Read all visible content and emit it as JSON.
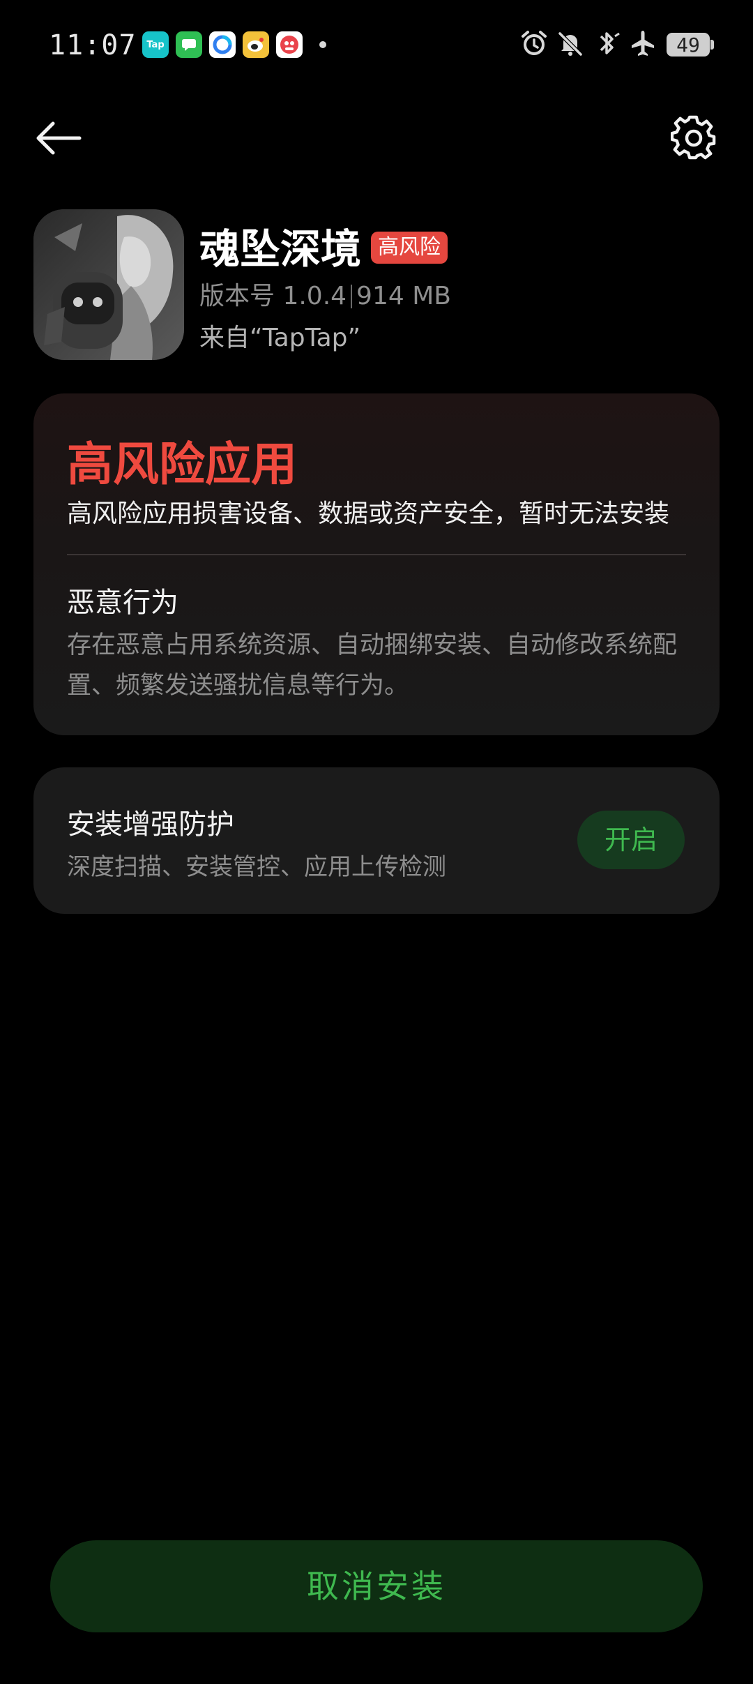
{
  "status_bar": {
    "time": "11:07",
    "notification_icons": [
      {
        "name": "taptap-app-icon",
        "label": "Tap",
        "color": "#17c3c9"
      },
      {
        "name": "messages-app-icon",
        "label": "",
        "color": "#2fbf54"
      },
      {
        "name": "browser-app-icon",
        "label": "",
        "color": "#2f7ff0"
      },
      {
        "name": "weibo-app-icon",
        "label": "",
        "color": "#f0a32e"
      },
      {
        "name": "game-app-icon",
        "label": "",
        "color": "#e9434b"
      }
    ],
    "battery_level": "49"
  },
  "app": {
    "name": "魂坠深境",
    "risk_badge": "高风险",
    "version": "版本号 1.0.4",
    "size": "914 MB",
    "source": "来自“TapTap”"
  },
  "risk_card": {
    "title": "高风险应用",
    "description": "高风险应用损害设备、数据或资产安全，暂时无法安装",
    "behavior_title": "恶意行为",
    "behavior_description": "存在恶意占用系统资源、自动捆绑安装、自动修改系统配置、频繁发送骚扰信息等行为。"
  },
  "protection_card": {
    "title": "安装增强防护",
    "description": "深度扫描、安装管控、应用上传检测",
    "button_label": "开启"
  },
  "bottom": {
    "cancel_label": "取消安装"
  },
  "colors": {
    "background": "#000000",
    "risk_red": "#ef4a3f",
    "accent_green": "#3fb94f",
    "card_bg": "#1b1b1b"
  }
}
